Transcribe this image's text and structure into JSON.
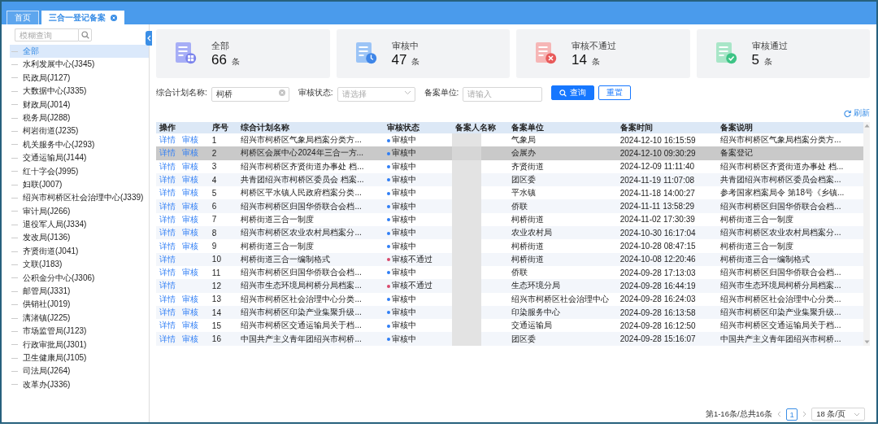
{
  "tabs": [
    {
      "label": "首页",
      "selected": false,
      "closable": false
    },
    {
      "label": "三合一登记备案",
      "selected": true,
      "closable": true
    }
  ],
  "sidebar": {
    "search": {
      "placeholder": "模糊查询"
    },
    "items": [
      {
        "label": "全部",
        "selected": true
      },
      {
        "label": "水利发展中心(J345)",
        "selected": false
      },
      {
        "label": "民政局(J127)",
        "selected": false
      },
      {
        "label": "大数据中心(J335)",
        "selected": false
      },
      {
        "label": "财政局(J014)",
        "selected": false
      },
      {
        "label": "税务局(J288)",
        "selected": false
      },
      {
        "label": "柯岩街道(J235)",
        "selected": false
      },
      {
        "label": "机关服务中心(J293)",
        "selected": false
      },
      {
        "label": "交通运输局(J144)",
        "selected": false
      },
      {
        "label": "红十字会(J995)",
        "selected": false
      },
      {
        "label": "妇联(J007)",
        "selected": false
      },
      {
        "label": "绍兴市柯桥区社会治理中心(J339)",
        "selected": false
      },
      {
        "label": "审计局(J266)",
        "selected": false
      },
      {
        "label": "退役军人局(J334)",
        "selected": false
      },
      {
        "label": "发改局(J136)",
        "selected": false
      },
      {
        "label": "齐贤街道(J041)",
        "selected": false
      },
      {
        "label": "文联(J183)",
        "selected": false
      },
      {
        "label": "公积金分中心(J306)",
        "selected": false
      },
      {
        "label": "邮管局(J331)",
        "selected": false
      },
      {
        "label": "供销社(J019)",
        "selected": false
      },
      {
        "label": "漓渚镇(J225)",
        "selected": false
      },
      {
        "label": "市场监管局(J123)",
        "selected": false
      },
      {
        "label": "行政审批局(J301)",
        "selected": false
      },
      {
        "label": "卫生健康局(J105)",
        "selected": false
      },
      {
        "label": "司法局(J264)",
        "selected": false
      },
      {
        "label": "改革办(J336)",
        "selected": false
      }
    ]
  },
  "stats": [
    {
      "kind": "all",
      "label": "全部",
      "count": "66",
      "unit": "条"
    },
    {
      "kind": "pending",
      "label": "审核中",
      "count": "47",
      "unit": "条"
    },
    {
      "kind": "rejected",
      "label": "审核不通过",
      "count": "14",
      "unit": "条"
    },
    {
      "kind": "approved",
      "label": "审核通过",
      "count": "5",
      "unit": "条"
    }
  ],
  "filters": {
    "name": {
      "label": "综合计划名称:",
      "value": "柯桥"
    },
    "status": {
      "label": "审核状态:",
      "placeholder": "请选择"
    },
    "unit": {
      "label": "备案单位:",
      "placeholder": "请输入"
    },
    "buttons": [
      {
        "kind": "primary",
        "label": "查询"
      },
      {
        "kind": "default",
        "label": "重置"
      }
    ]
  },
  "refresh": "刷新",
  "table": {
    "columns": [
      "操作",
      "序号",
      "综合计划名称",
      "审核状态",
      "备案人名称",
      "备案单位",
      "备案时间",
      "备案说明"
    ],
    "rows": [
      {
        "selected": false,
        "actions": [
          "详情",
          "审核"
        ],
        "index": "1",
        "name": "绍兴市柯桥区气象局档案分类方...",
        "status": {
          "text": "审核中",
          "color": "#2f7ef5"
        },
        "applicant_redacted": true,
        "unit": "气象局",
        "time": "2024-12-10 16:15:59",
        "note": "绍兴市柯桥区气象局档案分类方..."
      },
      {
        "selected": true,
        "actions": [
          "详情",
          "审核"
        ],
        "index": "2",
        "name": "柯桥区会展中心2024年三合一方...",
        "status": {
          "text": "审核中",
          "color": "#2f7ef5"
        },
        "applicant_redacted": true,
        "unit": "会展办",
        "time": "2024-12-10 09:30:29",
        "note": "备案登记"
      },
      {
        "selected": false,
        "actions": [
          "详情",
          "审核"
        ],
        "index": "3",
        "name": "绍兴市柯桥区齐贤街道办事处 档...",
        "status": {
          "text": "审核中",
          "color": "#2f7ef5"
        },
        "applicant_redacted": true,
        "unit": "齐贤街道",
        "time": "2024-12-09 11:11:40",
        "note": "绍兴市柯桥区齐贤街道办事处 档..."
      },
      {
        "selected": false,
        "actions": [
          "详情",
          "审核"
        ],
        "index": "4",
        "name": "共青团绍兴市柯桥区委员会 档案...",
        "status": {
          "text": "审核中",
          "color": "#2f7ef5"
        },
        "applicant_redacted": true,
        "unit": "团区委",
        "time": "2024-11-19 11:07:08",
        "note": "共青团绍兴市柯桥区委员会档案..."
      },
      {
        "selected": false,
        "actions": [
          "详情",
          "审核"
        ],
        "index": "5",
        "name": "柯桥区平水镇人民政府档案分类...",
        "status": {
          "text": "审核中",
          "color": "#2f7ef5"
        },
        "applicant_redacted": true,
        "unit": "平水镇",
        "time": "2024-11-18 14:00:27",
        "note": "参考国家档案局令 第18号《乡镇..."
      },
      {
        "selected": false,
        "actions": [
          "详情",
          "审核"
        ],
        "index": "6",
        "name": "绍兴市柯桥区归国华侨联合会档...",
        "status": {
          "text": "审核中",
          "color": "#2f7ef5"
        },
        "applicant_redacted": true,
        "unit": "侨联",
        "time": "2024-11-11 13:58:29",
        "note": "绍兴市柯桥区归国华侨联合会档..."
      },
      {
        "selected": false,
        "actions": [
          "详情",
          "审核"
        ],
        "index": "7",
        "name": "柯桥街道三合一制度",
        "status": {
          "text": "审核中",
          "color": "#2f7ef5"
        },
        "applicant_redacted": true,
        "unit": "柯桥街道",
        "time": "2024-11-02 17:30:39",
        "note": "柯桥街道三合一制度"
      },
      {
        "selected": false,
        "actions": [
          "详情",
          "审核"
        ],
        "index": "8",
        "name": "绍兴市柯桥区农业农村局档案分...",
        "status": {
          "text": "审核中",
          "color": "#2f7ef5"
        },
        "applicant_redacted": true,
        "unit": "农业农村局",
        "time": "2024-10-30 16:17:04",
        "note": "绍兴市柯桥区农业农村局档案分..."
      },
      {
        "selected": false,
        "actions": [
          "详情",
          "审核"
        ],
        "index": "9",
        "name": "柯桥街道三合一制度",
        "status": {
          "text": "审核中",
          "color": "#2f7ef5"
        },
        "applicant_redacted": true,
        "unit": "柯桥街道",
        "time": "2024-10-28 08:47:15",
        "note": "柯桥街道三合一制度"
      },
      {
        "selected": false,
        "actions": [
          "详情"
        ],
        "index": "10",
        "name": "柯桥街道三合一编制格式",
        "status": {
          "text": "审核不通过",
          "color": "#d9486b"
        },
        "applicant_redacted": true,
        "unit": "柯桥街道",
        "time": "2024-10-08 12:20:46",
        "note": "柯桥街道三合一编制格式"
      },
      {
        "selected": false,
        "actions": [
          "详情",
          "审核"
        ],
        "index": "11",
        "name": "绍兴市柯桥区归国华侨联合会档...",
        "status": {
          "text": "审核中",
          "color": "#2f7ef5"
        },
        "applicant_redacted": true,
        "unit": "侨联",
        "time": "2024-09-28 17:13:03",
        "note": "绍兴市柯桥区归国华侨联合会档..."
      },
      {
        "selected": false,
        "actions": [
          "详情"
        ],
        "index": "12",
        "name": "绍兴市生态环境局柯桥分局档案...",
        "status": {
          "text": "审核不通过",
          "color": "#d9486b"
        },
        "applicant_redacted": true,
        "unit": "生态环境分局",
        "time": "2024-09-28 16:44:19",
        "note": "绍兴市生态环境局柯桥分局档案..."
      },
      {
        "selected": false,
        "actions": [
          "详情",
          "审核"
        ],
        "index": "13",
        "name": "绍兴市柯桥区社会治理中心分类...",
        "status": {
          "text": "审核中",
          "color": "#2f7ef5"
        },
        "applicant_redacted": true,
        "unit": "绍兴市柯桥区社会治理中心",
        "time": "2024-09-28 16:24:03",
        "note": "绍兴市柯桥区社会治理中心分类..."
      },
      {
        "selected": false,
        "actions": [
          "详情",
          "审核"
        ],
        "index": "14",
        "name": "绍兴市柯桥区印染产业集聚升级...",
        "status": {
          "text": "审核中",
          "color": "#2f7ef5"
        },
        "applicant_redacted": true,
        "unit": "印染服务中心",
        "time": "2024-09-28 16:13:58",
        "note": "绍兴市柯桥区印染产业集聚升级..."
      },
      {
        "selected": false,
        "actions": [
          "详情",
          "审核"
        ],
        "index": "15",
        "name": "绍兴市柯桥区交通运输局关于档...",
        "status": {
          "text": "审核中",
          "color": "#2f7ef5"
        },
        "applicant_redacted": true,
        "unit": "交通运输局",
        "time": "2024-09-28 16:12:50",
        "note": "绍兴市柯桥区交通运输局关于档..."
      },
      {
        "selected": false,
        "actions": [
          "详情",
          "审核"
        ],
        "index": "16",
        "name": "中国共产主义青年团绍兴市柯桥...",
        "status": {
          "text": "审核中",
          "color": "#2f7ef5"
        },
        "applicant_redacted": true,
        "unit": "团区委",
        "time": "2024-09-28 15:16:07",
        "note": "中国共产主义青年团绍兴市柯桥..."
      }
    ]
  },
  "pagination": {
    "summary": "第1-16条/总共16条",
    "pages": [
      {
        "label": "1",
        "selected": true
      }
    ],
    "page_size": "18 条/页"
  }
}
